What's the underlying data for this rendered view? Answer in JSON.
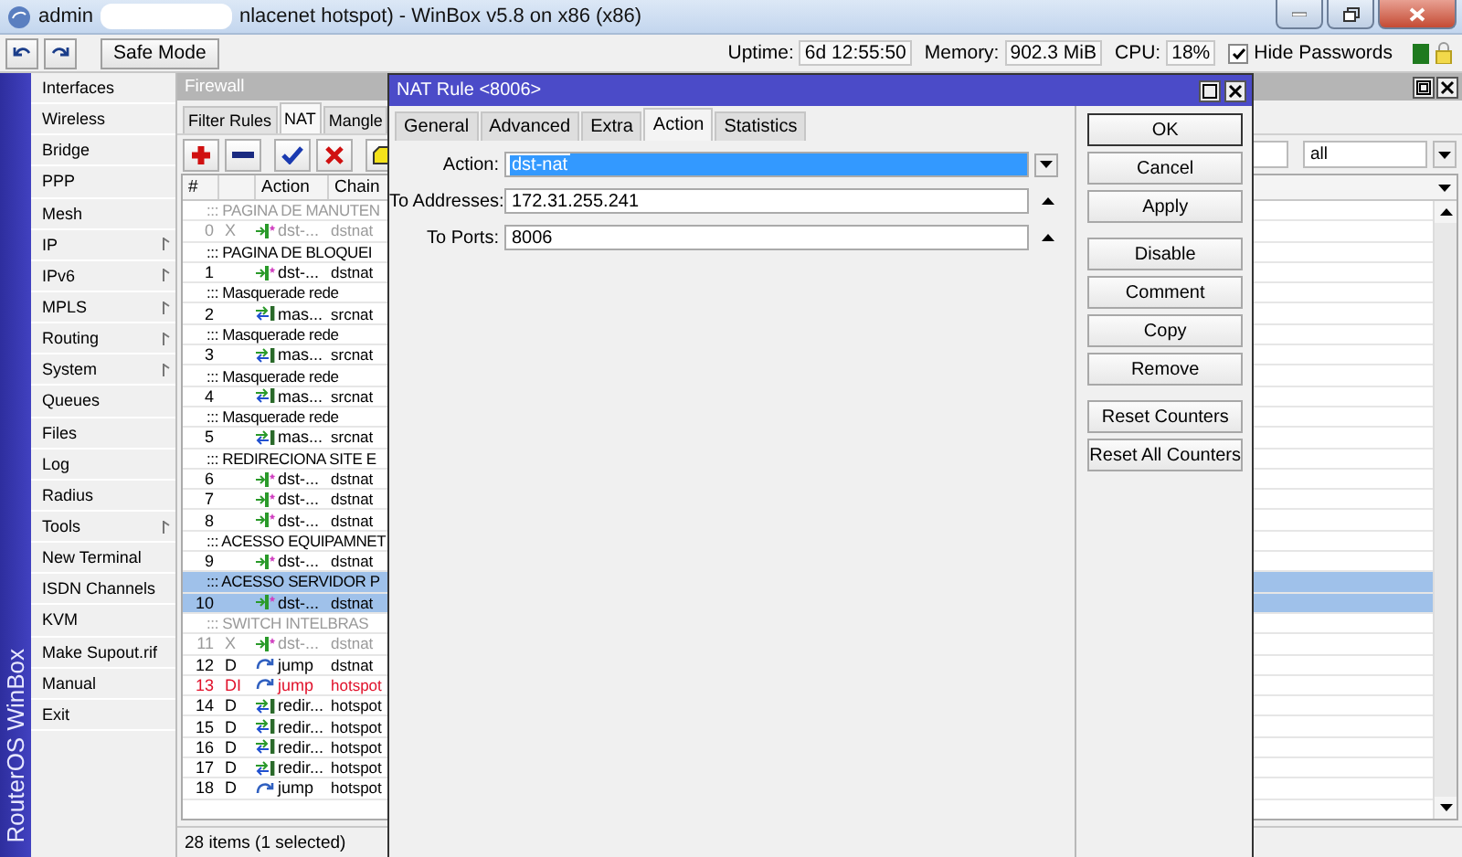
{
  "window": {
    "title_parts": [
      "admin",
      "nlacenet hotspot) - WinBox v5.8 on x86 (x86)"
    ]
  },
  "toolbar": {
    "safe_mode": "Safe Mode",
    "status": [
      {
        "label": "Uptime:",
        "value": "6d 12:55:50"
      },
      {
        "label": "Memory:",
        "value": "902.3 MiB"
      },
      {
        "label": "CPU:",
        "value": "18%"
      }
    ],
    "hide_passwords": {
      "label": "Hide Passwords",
      "checked": true
    }
  },
  "sidebar": {
    "brand": "RouterOS WinBox",
    "items": [
      {
        "label": "Interfaces",
        "has_submenu": false
      },
      {
        "label": "Wireless",
        "has_submenu": false
      },
      {
        "label": "Bridge",
        "has_submenu": false
      },
      {
        "label": "PPP",
        "has_submenu": false
      },
      {
        "label": "Mesh",
        "has_submenu": false
      },
      {
        "label": "IP",
        "has_submenu": true
      },
      {
        "label": "IPv6",
        "has_submenu": true
      },
      {
        "label": "MPLS",
        "has_submenu": true
      },
      {
        "label": "Routing",
        "has_submenu": true
      },
      {
        "label": "System",
        "has_submenu": true
      },
      {
        "label": "Queues",
        "has_submenu": false
      },
      {
        "label": "Files",
        "has_submenu": false
      },
      {
        "label": "Log",
        "has_submenu": false
      },
      {
        "label": "Radius",
        "has_submenu": false
      },
      {
        "label": "Tools",
        "has_submenu": true
      },
      {
        "label": "New Terminal",
        "has_submenu": false
      },
      {
        "label": "ISDN Channels",
        "has_submenu": false
      },
      {
        "label": "KVM",
        "has_submenu": false
      },
      {
        "label": "Make Supout.rif",
        "has_submenu": false
      },
      {
        "label": "Manual",
        "has_submenu": false
      },
      {
        "label": "Exit",
        "has_submenu": false
      }
    ]
  },
  "firewall": {
    "title": "Firewall",
    "tabs": [
      {
        "label": "Filter Rules",
        "selected": false
      },
      {
        "label": "NAT",
        "selected": true
      },
      {
        "label": "Mangle",
        "selected": false
      }
    ],
    "filter": {
      "value": "all"
    },
    "columns": [
      "#",
      "Action",
      "Chain"
    ],
    "rows": [
      {
        "kind": "comment",
        "text": "::: PAGINA DE MANUTEN",
        "disabled": true,
        "selected": false
      },
      {
        "kind": "dstnat",
        "number": "0",
        "flags": "X",
        "action": "dst-...",
        "chain": "dstnat",
        "disabled": true,
        "invalid": false,
        "selected": false
      },
      {
        "kind": "comment",
        "text": "::: PAGINA DE BLOQUEI",
        "disabled": false,
        "selected": false
      },
      {
        "kind": "dstnat",
        "number": "1",
        "action": "dst-...",
        "chain": "dstnat",
        "disabled": false,
        "invalid": false,
        "selected": false
      },
      {
        "kind": "comment",
        "text": "::: Masquerade rede",
        "disabled": false,
        "selected": false
      },
      {
        "kind": "masquerade",
        "number": "2",
        "action": "mas...",
        "chain": "srcnat",
        "disabled": false,
        "invalid": false,
        "selected": false
      },
      {
        "kind": "comment",
        "text": "::: Masquerade rede",
        "disabled": false,
        "selected": false
      },
      {
        "kind": "masquerade",
        "number": "3",
        "action": "mas...",
        "chain": "srcnat",
        "disabled": false,
        "invalid": false,
        "selected": false
      },
      {
        "kind": "comment",
        "text": "::: Masquerade rede",
        "disabled": false,
        "selected": false
      },
      {
        "kind": "masquerade",
        "number": "4",
        "action": "mas...",
        "chain": "srcnat",
        "disabled": false,
        "invalid": false,
        "selected": false
      },
      {
        "kind": "comment",
        "text": "::: Masquerade rede",
        "disabled": false,
        "selected": false
      },
      {
        "kind": "masquerade",
        "number": "5",
        "action": "mas...",
        "chain": "srcnat",
        "disabled": false,
        "invalid": false,
        "selected": false
      },
      {
        "kind": "comment",
        "text": "::: REDIRECIONA SITE E",
        "disabled": false,
        "selected": false
      },
      {
        "kind": "dstnat",
        "number": "6",
        "action": "dst-...",
        "chain": "dstnat",
        "disabled": false,
        "invalid": false,
        "selected": false
      },
      {
        "kind": "dstnat",
        "number": "7",
        "action": "dst-...",
        "chain": "dstnat",
        "disabled": false,
        "invalid": false,
        "selected": false
      },
      {
        "kind": "dstnat",
        "number": "8",
        "action": "dst-...",
        "chain": "dstnat",
        "disabled": false,
        "invalid": false,
        "selected": false
      },
      {
        "kind": "comment",
        "text": "::: ACESSO EQUIPAMNET",
        "disabled": false,
        "selected": false
      },
      {
        "kind": "dstnat",
        "number": "9",
        "action": "dst-...",
        "chain": "dstnat",
        "disabled": false,
        "invalid": false,
        "selected": false
      },
      {
        "kind": "comment",
        "text": "::: ACESSO SERVIDOR P",
        "disabled": false,
        "selected": true
      },
      {
        "kind": "dstnat",
        "number": "10",
        "action": "dst-...",
        "chain": "dstnat",
        "disabled": false,
        "invalid": false,
        "selected": true
      },
      {
        "kind": "comment",
        "text": "::: SWITCH INTELBRAS",
        "disabled": true,
        "selected": false
      },
      {
        "kind": "dstnat",
        "number": "11",
        "flags": "X",
        "action": "dst-...",
        "chain": "dstnat",
        "disabled": true,
        "invalid": false,
        "selected": false
      },
      {
        "kind": "jump",
        "number": "12",
        "flags": "D",
        "action": "jump",
        "chain": "dstnat",
        "disabled": false,
        "invalid": false,
        "selected": false
      },
      {
        "kind": "jump",
        "number": "13",
        "flags": "DI",
        "action": "jump",
        "chain": "hotspot",
        "disabled": false,
        "invalid": true,
        "selected": false
      },
      {
        "kind": "redirect",
        "number": "14",
        "flags": "D",
        "action": "redir...",
        "chain": "hotspot",
        "disabled": false,
        "invalid": false,
        "selected": false
      },
      {
        "kind": "redirect",
        "number": "15",
        "flags": "D",
        "action": "redir...",
        "chain": "hotspot",
        "disabled": false,
        "invalid": false,
        "selected": false
      },
      {
        "kind": "redirect",
        "number": "16",
        "flags": "D",
        "action": "redir...",
        "chain": "hotspot",
        "disabled": false,
        "invalid": false,
        "selected": false
      },
      {
        "kind": "redirect",
        "number": "17",
        "flags": "D",
        "action": "redir...",
        "chain": "hotspot",
        "disabled": false,
        "invalid": false,
        "selected": false
      },
      {
        "kind": "jump",
        "number": "18",
        "flags": "D",
        "action": "jump",
        "chain": "hotspot",
        "disabled": false,
        "invalid": false,
        "selected": false
      }
    ],
    "status": "28 items (1 selected)"
  },
  "dialog": {
    "title": "NAT Rule <8006>",
    "tabs": [
      {
        "label": "General",
        "selected": false
      },
      {
        "label": "Advanced",
        "selected": false
      },
      {
        "label": "Extra",
        "selected": false
      },
      {
        "label": "Action",
        "selected": true
      },
      {
        "label": "Statistics",
        "selected": false
      }
    ],
    "fields": [
      {
        "kind": "dropdown",
        "label": "Action:",
        "value": "dst-nat",
        "text_selected": true
      },
      {
        "kind": "text",
        "label": "To Addresses:",
        "value": "172.31.255.241",
        "text_selected": false
      },
      {
        "kind": "text",
        "label": "To Ports:",
        "value": "8006",
        "text_selected": false
      }
    ],
    "button_groups": [
      [
        {
          "label": "OK",
          "default": true
        },
        {
          "label": "Cancel",
          "default": false
        },
        {
          "label": "Apply",
          "default": false
        }
      ],
      [
        {
          "label": "Disable",
          "default": false
        },
        {
          "label": "Comment",
          "default": false
        },
        {
          "label": "Copy",
          "default": false
        },
        {
          "label": "Remove",
          "default": false
        }
      ],
      [
        {
          "label": "Reset Counters",
          "default": false
        },
        {
          "label": "Reset All Counters",
          "default": false
        }
      ]
    ]
  }
}
